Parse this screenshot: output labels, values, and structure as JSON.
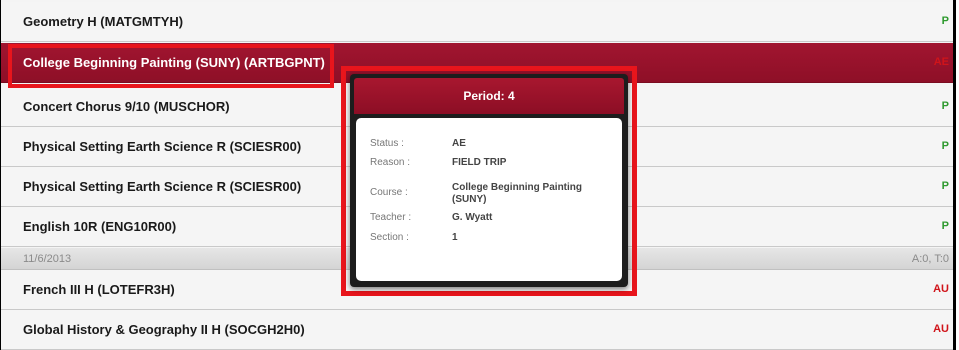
{
  "colors": {
    "accent": "#9b1230",
    "present": "#2e9a2e",
    "absent": "#d0141a",
    "highlight": "#e8151c"
  },
  "rows": [
    {
      "title": "Geometry H (MATGMTYH)",
      "status": "P"
    },
    {
      "title": "College Beginning Painting (SUNY) (ARTBGPNT)",
      "status": "AE"
    },
    {
      "title": "Concert Chorus 9/10 (MUSCHOR)",
      "status": "P"
    },
    {
      "title": "Physical Setting Earth Science R (SCIESR00)",
      "status": "P"
    },
    {
      "title": "Physical Setting Earth Science R (SCIESR00)",
      "status": "P"
    },
    {
      "title": "English 10R (ENG10R00)",
      "status": "P"
    }
  ],
  "date_header": {
    "date": "11/6/2013",
    "counts": "A:0, T:0"
  },
  "rows_after": [
    {
      "title": "French III H (LOTEFR3H)",
      "status": "AU"
    },
    {
      "title": "Global History & Geography II H (SOCGH2H0)",
      "status": "AU"
    }
  ],
  "popup": {
    "title": "Period: 4",
    "status_label": "Status :",
    "status_value": "AE",
    "reason_label": "Reason :",
    "reason_value": "FIELD TRIP",
    "course_label": "Course :",
    "course_value": "College Beginning Painting (SUNY)",
    "teacher_label": "Teacher :",
    "teacher_value": "G. Wyatt",
    "section_label": "Section :",
    "section_value": "1"
  }
}
